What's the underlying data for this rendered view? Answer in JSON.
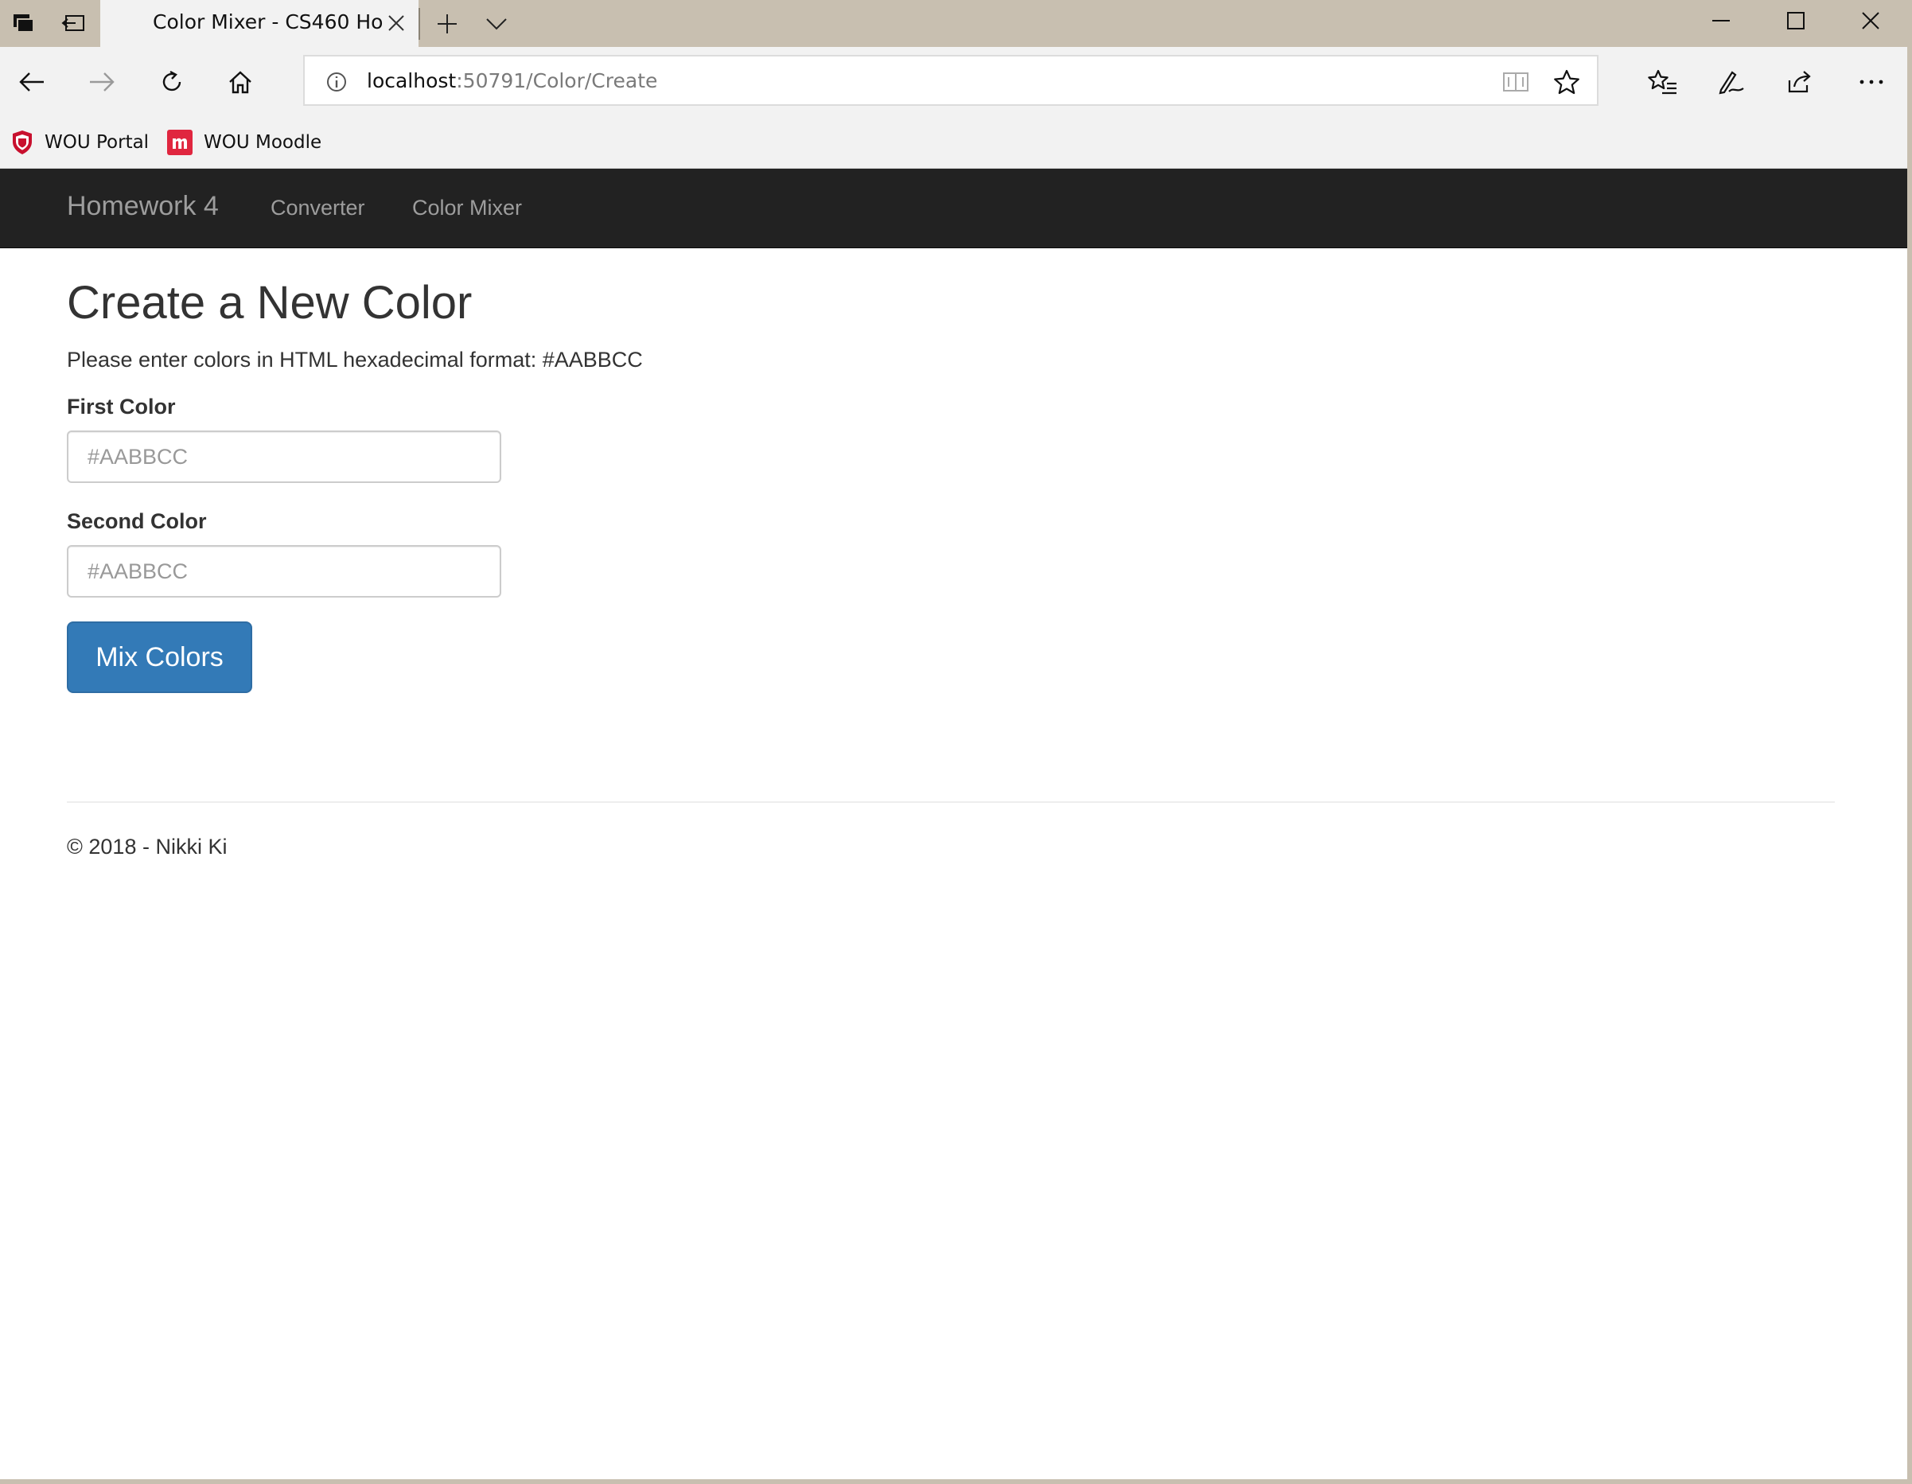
{
  "browser": {
    "tab": {
      "title": "Color Mixer - CS460 Ho"
    },
    "address": {
      "host": "localhost",
      "path": ":50791/Color/Create"
    },
    "favorites": [
      {
        "label": "WOU Portal",
        "icon": "shield-icon"
      },
      {
        "label": "WOU Moodle",
        "icon": "moodle-icon"
      }
    ]
  },
  "site": {
    "brand": "Homework 4",
    "nav": [
      "Converter",
      "Color Mixer"
    ]
  },
  "page": {
    "title": "Create a New Color",
    "hint": "Please enter colors in HTML hexadecimal format: #AABBCC",
    "first_label": "First Color",
    "first_placeholder": "#AABBCC",
    "first_value": "",
    "second_label": "Second Color",
    "second_placeholder": "#AABBCC",
    "second_value": "",
    "button": "Mix Colors"
  },
  "footer": {
    "text": "© 2018 - Nikki Ki"
  },
  "colors": {
    "navbar": "#222222",
    "primary_button": "#337ab7",
    "moodle": "#e0263f",
    "portal_shield": "#c8102e"
  }
}
